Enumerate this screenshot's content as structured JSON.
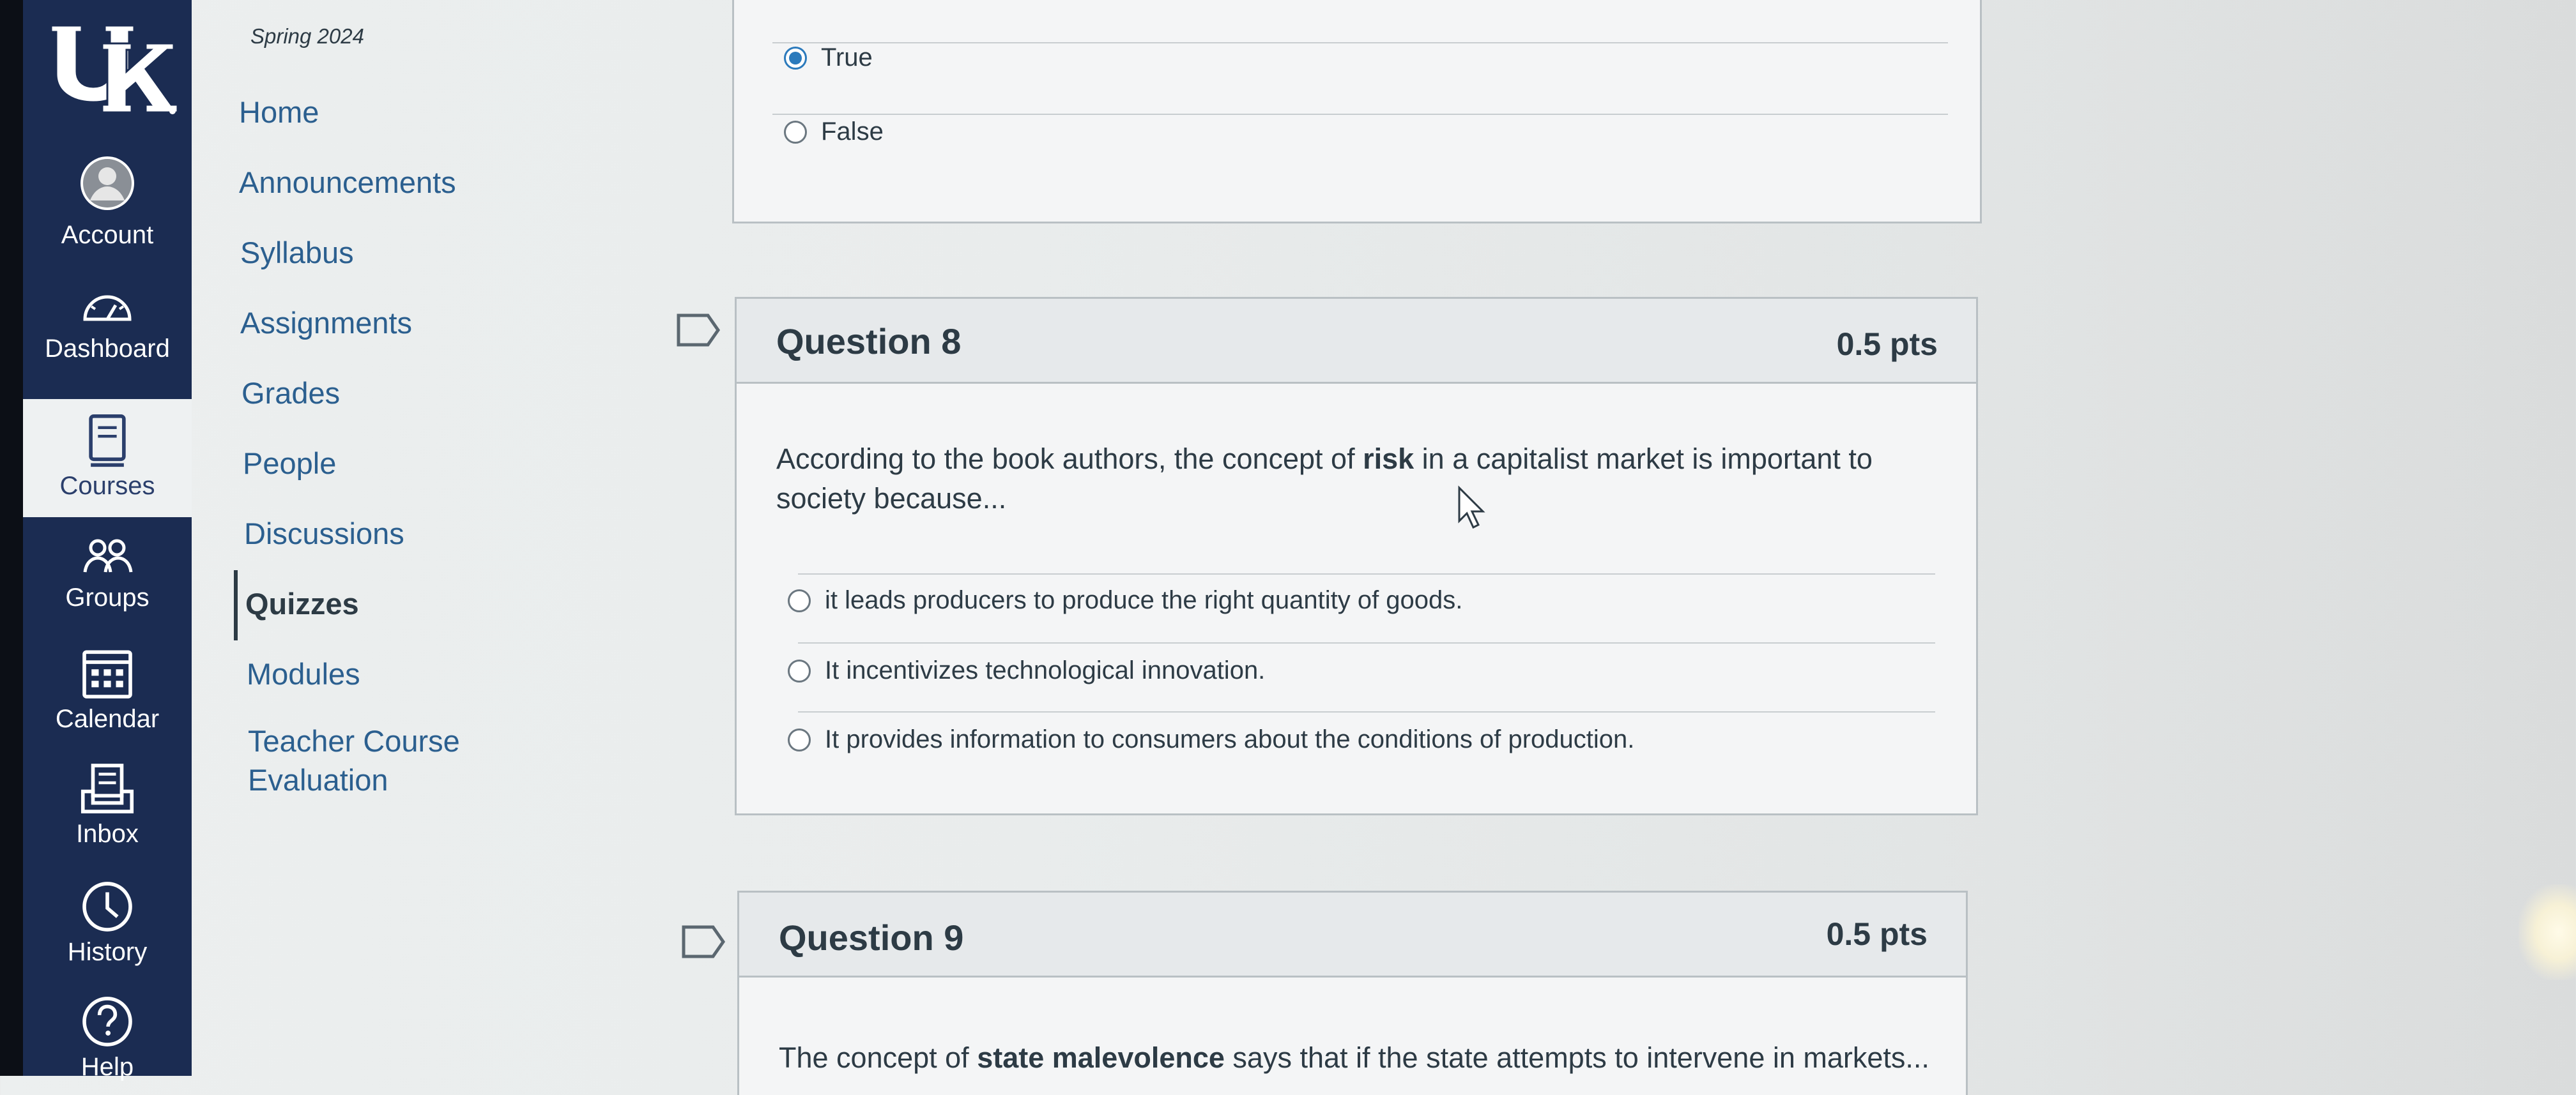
{
  "global_nav": {
    "logo_alt": "UK",
    "items": [
      {
        "label": "Account",
        "icon": "account-icon"
      },
      {
        "label": "Dashboard",
        "icon": "dashboard-icon"
      },
      {
        "label": "Courses",
        "icon": "courses-icon"
      },
      {
        "label": "Groups",
        "icon": "groups-icon"
      },
      {
        "label": "Calendar",
        "icon": "calendar-icon"
      },
      {
        "label": "Inbox",
        "icon": "inbox-icon"
      },
      {
        "label": "History",
        "icon": "history-icon"
      },
      {
        "label": "Help",
        "icon": "help-icon"
      }
    ],
    "active": "Courses"
  },
  "course_nav": {
    "term": "Spring 2024",
    "links": [
      "Home",
      "Announcements",
      "Syllabus",
      "Assignments",
      "Grades",
      "People",
      "Discussions",
      "Quizzes",
      "Modules",
      "Teacher Course",
      "Evaluation"
    ],
    "active": "Quizzes"
  },
  "prev_question": {
    "answers": [
      {
        "label": "True",
        "selected": true
      },
      {
        "label": "False",
        "selected": false
      }
    ]
  },
  "question8": {
    "title": "Question 8",
    "points": "0.5 pts",
    "text_before": "According to the book authors, the concept of ",
    "text_bold": "risk",
    "text_after": " in a capitalist market is important to society because...",
    "answers": [
      "it leads producers to produce the right quantity of goods.",
      "It incentivizes technological innovation.",
      "It provides information to consumers about the conditions of production."
    ]
  },
  "question9": {
    "title": "Question 9",
    "points": "0.5 pts",
    "text_before": "The concept of ",
    "text_bold": "state malevolence",
    "text_after": " says that if the state attempts to intervene in markets..."
  },
  "colors": {
    "nav_bg": "#1b2c52",
    "link": "#2b5f8f",
    "radio_selected": "#2b7abc"
  }
}
